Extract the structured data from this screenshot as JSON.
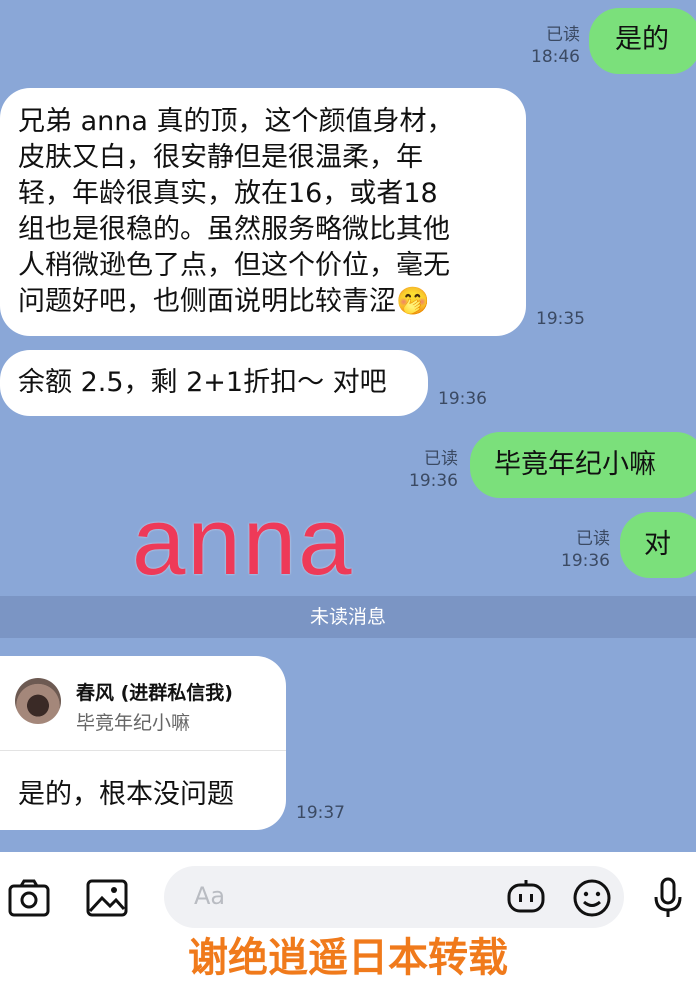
{
  "messages": {
    "m1": {
      "text": "是的",
      "read": "已读",
      "time": "18:46"
    },
    "m2": {
      "lines": [
        "兄弟 anna 真的顶，这个颜值身材，",
        "皮肤又白，很安静但是很温柔，年",
        "轻，年龄很真实，放在16，或者18",
        "组也是很稳的。虽然服务略微比其他",
        "人稍微逊色了点，但这个价位，毫无",
        "问题好吧，也侧面说明比较青涩🤭"
      ],
      "time": "19:35"
    },
    "m3": {
      "text": "余额 2.5，剩 2+1折扣～ 对吧",
      "time": "19:36"
    },
    "m4": {
      "text": "毕竟年纪小嘛",
      "read": "已读",
      "time": "19:36"
    },
    "m5": {
      "text": "对",
      "read": "已读",
      "time": "19:36"
    }
  },
  "watermark_text": "anna",
  "unread_label": "未读消息",
  "reply": {
    "name": "春风 (进群私信我)",
    "quote": "毕竟年纪小嘛",
    "text": "是的，根本没问题",
    "time": "19:37"
  },
  "composer": {
    "placeholder": "Aa",
    "icons": [
      "camera-icon",
      "image-icon",
      "bot-icon",
      "emoji-icon",
      "microphone-icon"
    ]
  },
  "footer_text": "谢绝逍遥日本转载"
}
